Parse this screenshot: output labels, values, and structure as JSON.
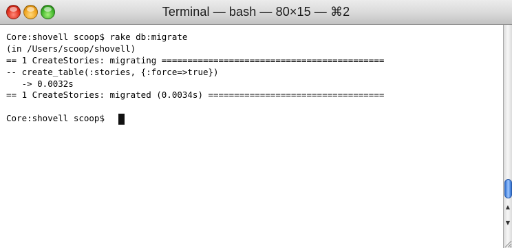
{
  "window": {
    "title": "Terminal — bash — 80×15 — ⌘2"
  },
  "terminal": {
    "lines": [
      "Core:shovell scoop$ rake db:migrate",
      "(in /Users/scoop/shovell)",
      "== 1 CreateStories: migrating ===========================================",
      "-- create_table(:stories, {:force=>true})",
      "   -> 0.0032s",
      "== 1 CreateStories: migrated (0.0034s) ==================================",
      ""
    ],
    "prompt": "Core:shovell scoop$"
  },
  "icons": {
    "close": "close-icon",
    "minimize": "minimize-icon",
    "zoom": "zoom-icon",
    "scroll_up": "scroll-up-arrow-icon",
    "scroll_down": "scroll-down-arrow-icon",
    "resize": "resize-grip-icon"
  },
  "colors": {
    "close": "#e0301e",
    "minimize": "#f0a420",
    "zoom": "#3fb42a",
    "scroll_thumb": "#2e6ed0",
    "text": "#000000",
    "background": "#ffffff"
  }
}
